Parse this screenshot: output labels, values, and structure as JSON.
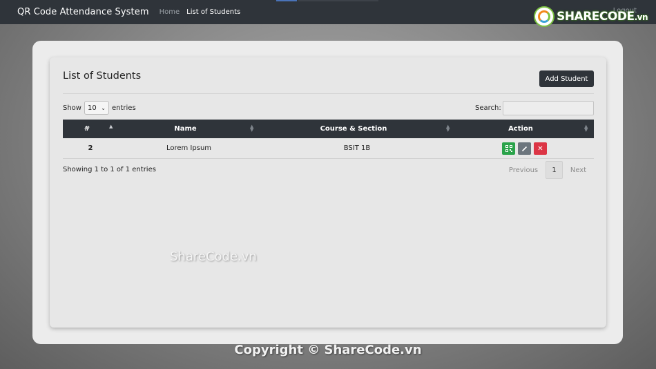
{
  "navbar": {
    "brand": "QR Code Attendance System",
    "links": [
      {
        "label": "Home",
        "active": false
      },
      {
        "label": "List of Students",
        "active": true
      }
    ],
    "logout": "Logout"
  },
  "logo": {
    "text": "SHARECODE",
    "suffix": ".vn"
  },
  "page": {
    "title": "List of Students",
    "add_button": "Add Student"
  },
  "table_controls": {
    "show_label": "Show",
    "entries_value": "10",
    "entries_label": "entries",
    "search_label": "Search:",
    "search_value": ""
  },
  "table": {
    "columns": [
      "#",
      "Name",
      "Course & Section",
      "Action"
    ],
    "rows": [
      {
        "id": "2",
        "name": "Lorem Ipsum",
        "course": "BSIT 1B"
      }
    ]
  },
  "footer_info": "Showing 1 to 1 of 1 entries",
  "pagination": {
    "previous": "Previous",
    "page": "1",
    "next": "Next"
  },
  "watermark": "ShareCode.vn",
  "copyright": "Copyright © ShareCode.vn",
  "colors": {
    "navbar": "#2f343a",
    "qr_button": "#2aa34a",
    "edit_button": "#6c757d",
    "delete_button": "#dc3545"
  }
}
